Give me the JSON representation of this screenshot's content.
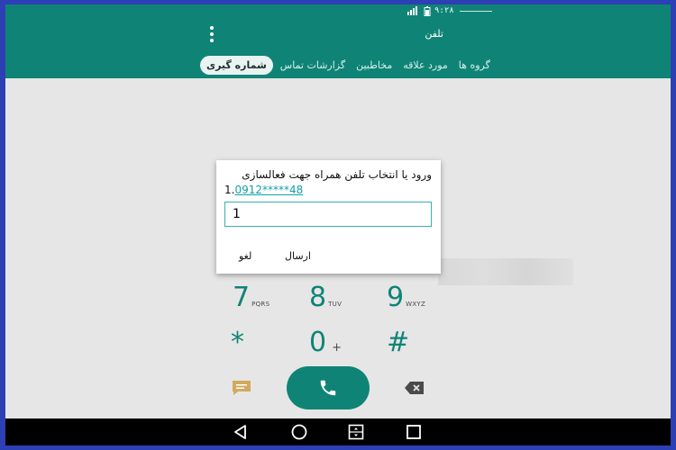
{
  "status_bar": {
    "time": "۹:۲۸"
  },
  "app": {
    "title": "تلفن"
  },
  "tabs": [
    {
      "label": "گروه ها"
    },
    {
      "label": "مورد علاقه"
    },
    {
      "label": "مخاطبین"
    },
    {
      "label": "گزارشات تماس"
    },
    {
      "label": "شماره گیری",
      "active": true
    }
  ],
  "dialpad": {
    "keys": [
      {
        "digit": "7",
        "letters": "PQRS"
      },
      {
        "digit": "8",
        "letters": "TUV"
      },
      {
        "digit": "9",
        "letters": "WXYZ"
      },
      {
        "digit": "*",
        "letters": ""
      },
      {
        "digit": "0",
        "letters": "+"
      },
      {
        "digit": "#",
        "letters": ""
      }
    ]
  },
  "dialog": {
    "title": "ورود یا انتخاب تلفن همراه جهت فعالسازی",
    "phone_prefix": "1.",
    "phone_number": "0912*****48",
    "input_value": "1",
    "send_label": "ارسال",
    "cancel_label": "لغو"
  },
  "colors": {
    "primary": "#0f8476",
    "accent": "#26c6b4",
    "link": "#13a0a8"
  },
  "icons": {
    "call": "phone-icon",
    "message": "message-icon",
    "backspace": "backspace-icon",
    "back": "nav-back-icon",
    "home": "nav-home-icon",
    "dual": "nav-dual-window-icon",
    "recents": "nav-recents-icon"
  }
}
